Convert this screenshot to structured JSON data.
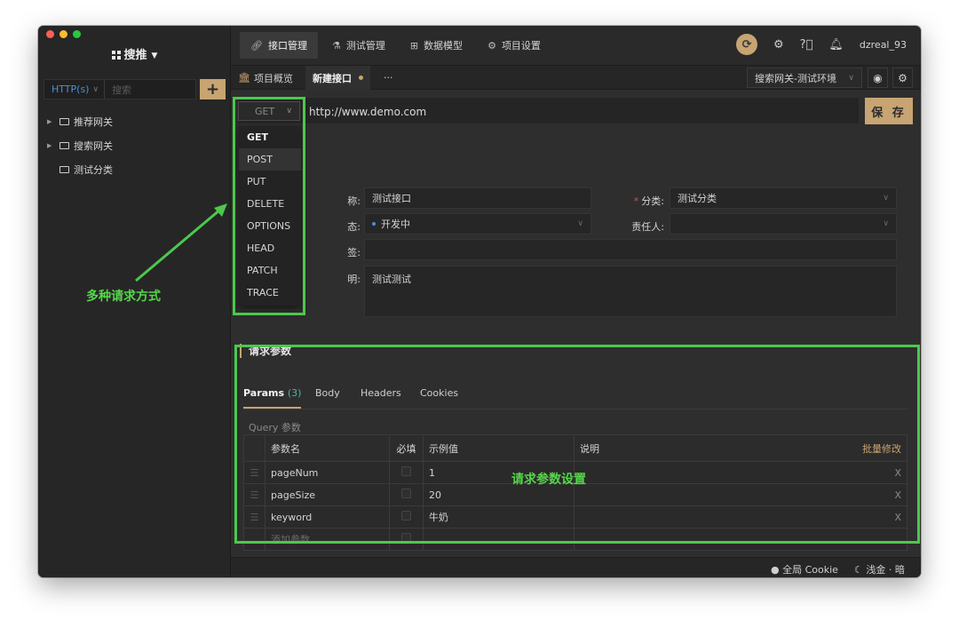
{
  "sidebar": {
    "project": "搜推",
    "protocol": "HTTP(s)",
    "search_placeholder": "搜索",
    "add": "+",
    "tree": [
      {
        "label": "推荐网关"
      },
      {
        "label": "搜索网关"
      },
      {
        "label": "测试分类"
      }
    ]
  },
  "topnav": {
    "items": [
      {
        "label": "接口管理"
      },
      {
        "label": "测试管理"
      },
      {
        "label": "数据模型"
      },
      {
        "label": "项目设置"
      }
    ],
    "user": "dzreal_93"
  },
  "tabs": {
    "items": [
      {
        "label": "项目概览"
      },
      {
        "label": "新建接口"
      }
    ],
    "more": "···",
    "env": "搜索网关-测试环境"
  },
  "request": {
    "method": "GET",
    "url": "http://www.demo.com",
    "save": "保 存"
  },
  "methods": [
    "GET",
    "POST",
    "PUT",
    "DELETE",
    "OPTIONS",
    "HEAD",
    "PATCH",
    "TRACE"
  ],
  "form": {
    "name_label": "称:",
    "name_value": "测试接口",
    "category_label": "分类:",
    "category_value": "测试分类",
    "status_label": "态:",
    "status_value": "开发中",
    "owner_label": "责任人:",
    "tag_label": "签:",
    "desc_label": "明:",
    "desc_value": "测试测试"
  },
  "params_section": {
    "title": "请求参数",
    "tabs": [
      {
        "label": "Params",
        "count": "(3)"
      },
      {
        "label": "Body"
      },
      {
        "label": "Headers"
      },
      {
        "label": "Cookies"
      }
    ],
    "query_label": "Query 参数",
    "columns": [
      "参数名",
      "必填",
      "示例值",
      "说明"
    ],
    "bulk_edit": "批量修改",
    "rows": [
      {
        "name": "pageNum",
        "value": "1",
        "delete": "X"
      },
      {
        "name": "pageSize",
        "value": "20",
        "delete": "X"
      },
      {
        "name": "keyword",
        "value": "牛奶",
        "delete": "X"
      }
    ],
    "add_placeholder": "添加参数"
  },
  "footer": {
    "cookie": "全局 Cookie",
    "theme": "浅金 · 暗"
  },
  "annotations": {
    "methods_note": "多种请求方式",
    "params_note": "请求参数设置"
  },
  "colors": {
    "accent": "#c7a472",
    "annotation": "#4cc84c"
  }
}
